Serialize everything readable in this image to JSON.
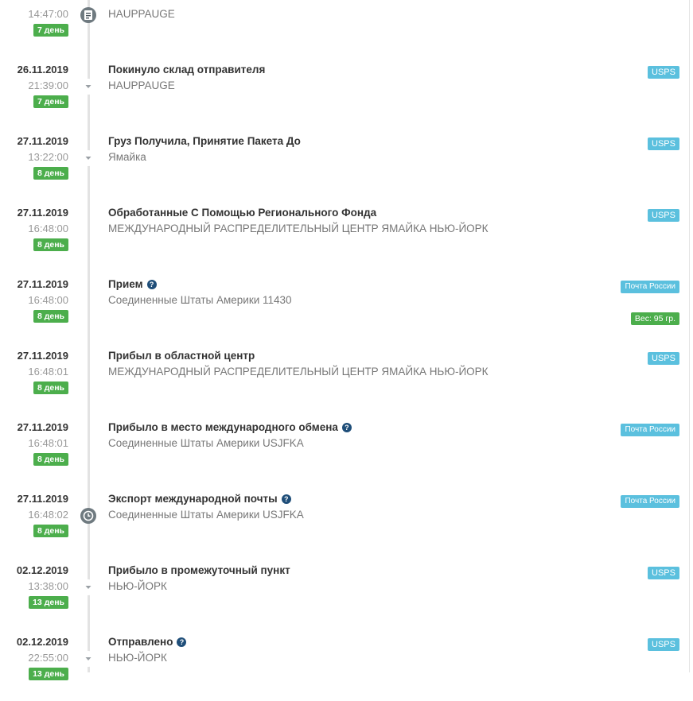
{
  "events": [
    {
      "date": "",
      "time": "14:47:00",
      "day_badge": "7 день",
      "title": "",
      "location": "HAUPPAUGE",
      "carrier": "",
      "weight": "",
      "icon": "document-icon",
      "help": false
    },
    {
      "date": "26.11.2019",
      "time": "21:39:00",
      "day_badge": "7 день",
      "title": "Покинуло склад отправителя",
      "location": "HAUPPAUGE",
      "carrier": "USPS",
      "weight": "",
      "icon": "chevron-down-icon",
      "help": false
    },
    {
      "date": "27.11.2019",
      "time": "13:22:00",
      "day_badge": "8 день",
      "title": "Груз Получила, Принятие Пакета До",
      "location": "Ямайка",
      "carrier": "USPS",
      "weight": "",
      "icon": "chevron-down-icon",
      "help": false
    },
    {
      "date": "27.11.2019",
      "time": "16:48:00",
      "day_badge": "8 день",
      "title": "Обработанные С Помощью Регионального Фонда",
      "location": "МЕЖДУНАРОДНЫЙ РАСПРЕДЕЛИТЕЛЬНЫЙ ЦЕНТР ЯМАЙКА НЬЮ-ЙОРК",
      "carrier": "USPS",
      "weight": "",
      "icon": "none",
      "help": false
    },
    {
      "date": "27.11.2019",
      "time": "16:48:00",
      "day_badge": "8 день",
      "title": "Прием",
      "location": "Соединенные Штаты Америки 11430",
      "carrier": "Почта России",
      "weight": "Вес: 95 гр.",
      "icon": "none",
      "help": true
    },
    {
      "date": "27.11.2019",
      "time": "16:48:01",
      "day_badge": "8 день",
      "title": "Прибыл в областной центр",
      "location": "МЕЖДУНАРОДНЫЙ РАСПРЕДЕЛИТЕЛЬНЫЙ ЦЕНТР ЯМАЙКА НЬЮ-ЙОРК",
      "carrier": "USPS",
      "weight": "",
      "icon": "none",
      "help": false
    },
    {
      "date": "27.11.2019",
      "time": "16:48:01",
      "day_badge": "8 день",
      "title": "Прибыло в место международного обмена",
      "location": "Соединенные Штаты Америки USJFKA",
      "carrier": "Почта России",
      "weight": "",
      "icon": "none",
      "help": true
    },
    {
      "date": "27.11.2019",
      "time": "16:48:02",
      "day_badge": "8 день",
      "title": "Экспорт международной почты",
      "location": "Соединенные Штаты Америки USJFKA",
      "carrier": "Почта России",
      "weight": "",
      "icon": "clock-icon",
      "help": true
    },
    {
      "date": "02.12.2019",
      "time": "13:38:00",
      "day_badge": "13 день",
      "title": "Прибыло в промежуточный пункт",
      "location": "НЬЮ-ЙОРК",
      "carrier": "USPS",
      "weight": "",
      "icon": "chevron-down-icon",
      "help": false
    },
    {
      "date": "02.12.2019",
      "time": "22:55:00",
      "day_badge": "13 день",
      "title": "Отправлено",
      "location": "НЬЮ-ЙОРК",
      "carrier": "USPS",
      "weight": "",
      "icon": "chevron-down-icon",
      "help": true
    }
  ],
  "colors": {
    "day_badge": "#4cae4c",
    "carrier_badge": "#5bc0de",
    "help_icon": "#1f4e79",
    "timeline": "#e3e3e3"
  },
  "help_glyph": "?"
}
